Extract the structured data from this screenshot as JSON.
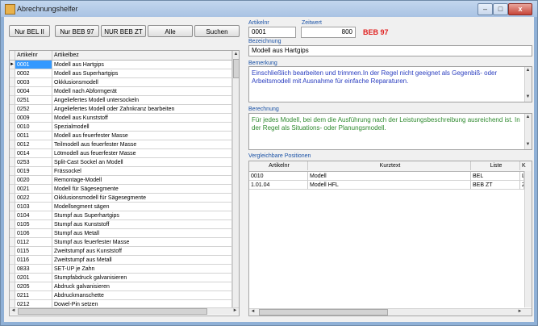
{
  "window": {
    "title": "Abrechnungshelfer",
    "min_label": "–",
    "max_label": "□",
    "close_label": "x"
  },
  "buttons": {
    "nur_bel2": "Nur BEL II",
    "nur_beb97": "Nur BEB 97",
    "nur_bebzt": "NUR BEB ZT",
    "alle": "Alle",
    "suchen": "Suchen"
  },
  "left_grid": {
    "headers": [
      "Artikelnr",
      "Artikelbez"
    ],
    "current_row_marker": "►",
    "rows": [
      [
        "0001",
        "Modell aus Hartgips"
      ],
      [
        "0002",
        "Modell aus Superhartgips"
      ],
      [
        "0003",
        "Okklusionsmodell"
      ],
      [
        "0004",
        "Modell nach Abformgerät"
      ],
      [
        "0251",
        "Angeliefertes Modell untersockeln"
      ],
      [
        "0252",
        "Angeliefertes Modell oder Zahnkranz bearbeiten"
      ],
      [
        "0009",
        "Modell aus Kunststoff"
      ],
      [
        "0010",
        "Spezialmodell"
      ],
      [
        "0011",
        "Modell aus feuerfester Masse"
      ],
      [
        "0012",
        "Teilmodell aus feuerfester Masse"
      ],
      [
        "0014",
        "Lötmodell aus feuerfester Masse"
      ],
      [
        "0253",
        "Split-Cast Sockel an Modell"
      ],
      [
        "0019",
        "Frässockel"
      ],
      [
        "0020",
        "Remontage-Modell"
      ],
      [
        "0021",
        "Modell für Sägesegmente"
      ],
      [
        "0022",
        "Okklusionsmodell für Sägesegmente"
      ],
      [
        "0103",
        "Modellsegment sägen"
      ],
      [
        "0104",
        "Stumpf aus Superhartgips"
      ],
      [
        "0105",
        "Stumpf aus Kunststoff"
      ],
      [
        "0106",
        "Stumpf aus Metall"
      ],
      [
        "0112",
        "Stumpf aus feuerfester Masse"
      ],
      [
        "0115",
        "Zweitstumpf aus Kunststoff"
      ],
      [
        "0116",
        "Zweitstumpf aus Metall"
      ],
      [
        "0833",
        "SET-UP je Zahn"
      ],
      [
        "0201",
        "Stumpfabdruck galvanisieren"
      ],
      [
        "0205",
        "Abdruck galvanisieren"
      ],
      [
        "0211",
        "Abdruckmanschette"
      ],
      [
        "0212",
        "Dowel-Pin setzen"
      ]
    ]
  },
  "detail": {
    "artikelnr_label": "Artikelnr",
    "artikelnr_value": "0001",
    "zeitwert_label": "Zeitwert",
    "zeitwert_value": "800",
    "catalog": "BEB 97",
    "bezeichnung_label": "Bezeichnung",
    "bezeichnung_value": "Modell aus Hartgips",
    "bemerkung_label": "Bemerkung",
    "bemerkung_text": "Einschließlich bearbeiten und trimmen.In der Regel nicht geeignet als Gegenbiß- oder Arbeitsmodell mit Ausnahme für einfache Reparaturen.",
    "berechnung_label": "Berechnung",
    "berechnung_text": "Für jedes Modell, bei dem die  Ausführung nach der Leistungsbeschreibung ausreichend ist. In der Regel als Situations- oder Planungsmodell."
  },
  "compare": {
    "label": "Vergleichbare Positionen",
    "headers": [
      "Artikelnr",
      "Kurztext",
      "Liste",
      "K"
    ],
    "rows": [
      [
        "0010",
        "Modell",
        "BEL",
        "L"
      ],
      [
        "1.01.04",
        "Modell HFL",
        "BEB ZT",
        "Z"
      ]
    ]
  },
  "colors": {
    "title_bg": "#a9c3e3",
    "selection": "#3399ff",
    "label_blue": "#1a52a6",
    "memo_blue": "#2a3dbf",
    "memo_green": "#2f8a2f",
    "catalog_red": "#e0201f"
  }
}
